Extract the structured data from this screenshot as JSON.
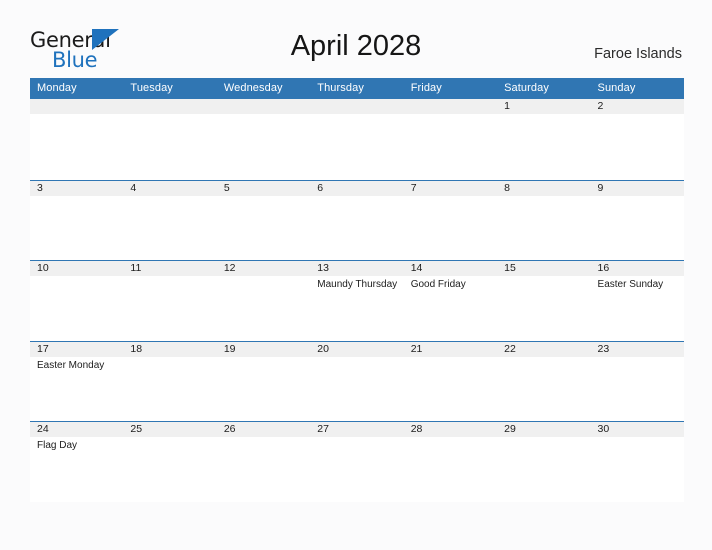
{
  "brand": {
    "name_part1": "General",
    "name_part2": "Blue",
    "flag_icon": "blue-flag-triangle-icon",
    "accent_color": "#1f72bd"
  },
  "header": {
    "title": "April 2028",
    "location": "Faroe Islands"
  },
  "theme": {
    "header_blue": "#3076b3",
    "date_band_gray": "#f0f0f0",
    "page_background": "#fbfbfc",
    "text_color": "#1c1c1c"
  },
  "calendar": {
    "month": "April",
    "year": "2028",
    "weekdays": [
      "Monday",
      "Tuesday",
      "Wednesday",
      "Thursday",
      "Friday",
      "Saturday",
      "Sunday"
    ],
    "weeks": [
      [
        {
          "date": "",
          "event": ""
        },
        {
          "date": "",
          "event": ""
        },
        {
          "date": "",
          "event": ""
        },
        {
          "date": "",
          "event": ""
        },
        {
          "date": "",
          "event": ""
        },
        {
          "date": "1",
          "event": ""
        },
        {
          "date": "2",
          "event": ""
        }
      ],
      [
        {
          "date": "3",
          "event": ""
        },
        {
          "date": "4",
          "event": ""
        },
        {
          "date": "5",
          "event": ""
        },
        {
          "date": "6",
          "event": ""
        },
        {
          "date": "7",
          "event": ""
        },
        {
          "date": "8",
          "event": ""
        },
        {
          "date": "9",
          "event": ""
        }
      ],
      [
        {
          "date": "10",
          "event": ""
        },
        {
          "date": "11",
          "event": ""
        },
        {
          "date": "12",
          "event": ""
        },
        {
          "date": "13",
          "event": "Maundy Thursday"
        },
        {
          "date": "14",
          "event": "Good Friday"
        },
        {
          "date": "15",
          "event": ""
        },
        {
          "date": "16",
          "event": "Easter Sunday"
        }
      ],
      [
        {
          "date": "17",
          "event": "Easter Monday"
        },
        {
          "date": "18",
          "event": ""
        },
        {
          "date": "19",
          "event": ""
        },
        {
          "date": "20",
          "event": ""
        },
        {
          "date": "21",
          "event": ""
        },
        {
          "date": "22",
          "event": ""
        },
        {
          "date": "23",
          "event": ""
        }
      ],
      [
        {
          "date": "24",
          "event": "Flag Day"
        },
        {
          "date": "25",
          "event": ""
        },
        {
          "date": "26",
          "event": ""
        },
        {
          "date": "27",
          "event": ""
        },
        {
          "date": "28",
          "event": ""
        },
        {
          "date": "29",
          "event": ""
        },
        {
          "date": "30",
          "event": ""
        }
      ]
    ]
  }
}
